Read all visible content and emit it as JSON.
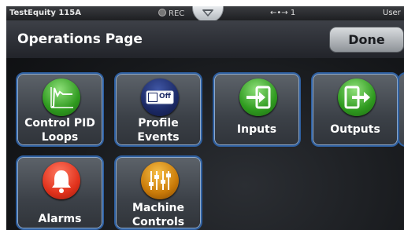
{
  "statusbar": {
    "device_name": "TestEquity 115A",
    "rec_label": "REC",
    "usb_label": "←•→ 1",
    "user_label": "User"
  },
  "header": {
    "title": "Operations Page",
    "done_label": "Done"
  },
  "tiles": [
    {
      "line1": "Control PID",
      "line2": "Loops",
      "icon": "pid-graph-icon"
    },
    {
      "line1": "Profile",
      "line2": "Events",
      "icon": "toggle-off-icon",
      "badge": "Off"
    },
    {
      "line1": "Inputs",
      "icon": "input-arrow-icon"
    },
    {
      "line1": "Outputs",
      "icon": "output-arrow-icon"
    },
    {
      "line1": "Alarms",
      "icon": "bell-icon"
    },
    {
      "line1": "Machine",
      "line2": "Controls",
      "icon": "sliders-icon"
    }
  ],
  "colors": {
    "tile_border": "#2e5fa0",
    "green_icon": "#2f9a1f",
    "red_icon": "#e1321c",
    "orange_icon": "#c97a08",
    "navy_icon": "#1c2a66"
  }
}
